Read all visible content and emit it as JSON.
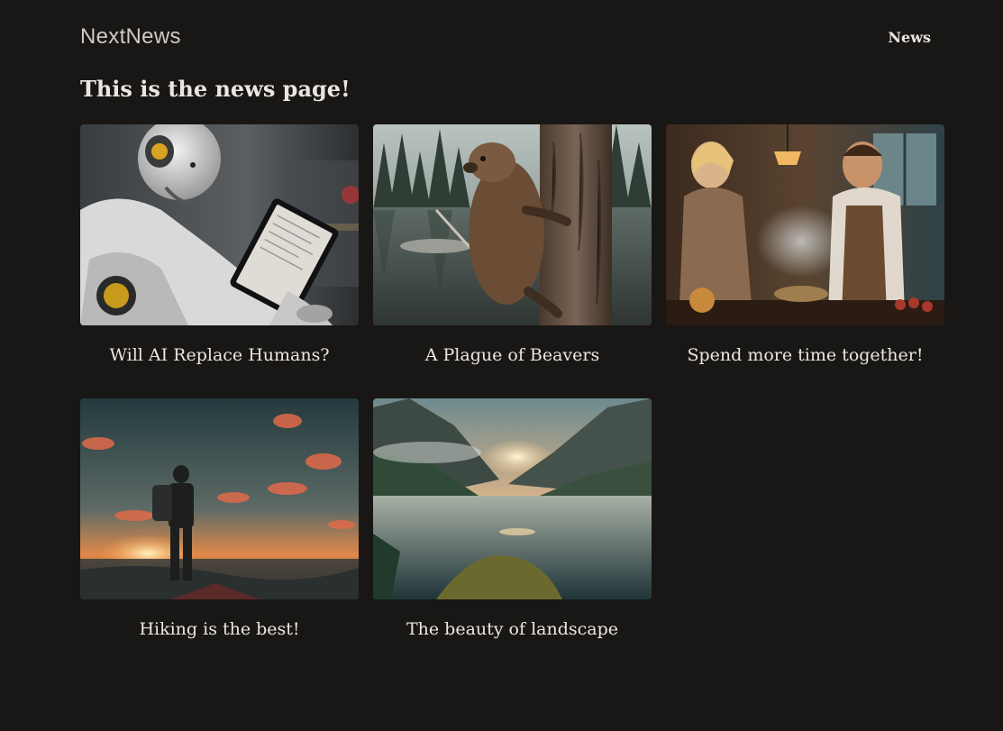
{
  "header": {
    "brand": "NextNews",
    "nav": {
      "news_label": "News"
    }
  },
  "page": {
    "title": "This is the news page!"
  },
  "articles": [
    {
      "title": "Will AI Replace Humans?",
      "image": "robot-with-tablet-image"
    },
    {
      "title": "A Plague of Beavers",
      "image": "beaver-climbing-tree-image"
    },
    {
      "title": "Spend more time together!",
      "image": "couple-cooking-image"
    },
    {
      "title": "Hiking is the best!",
      "image": "hiker-at-sunset-image"
    },
    {
      "title": "The beauty of landscape",
      "image": "mountain-lake-landscape-image"
    }
  ]
}
